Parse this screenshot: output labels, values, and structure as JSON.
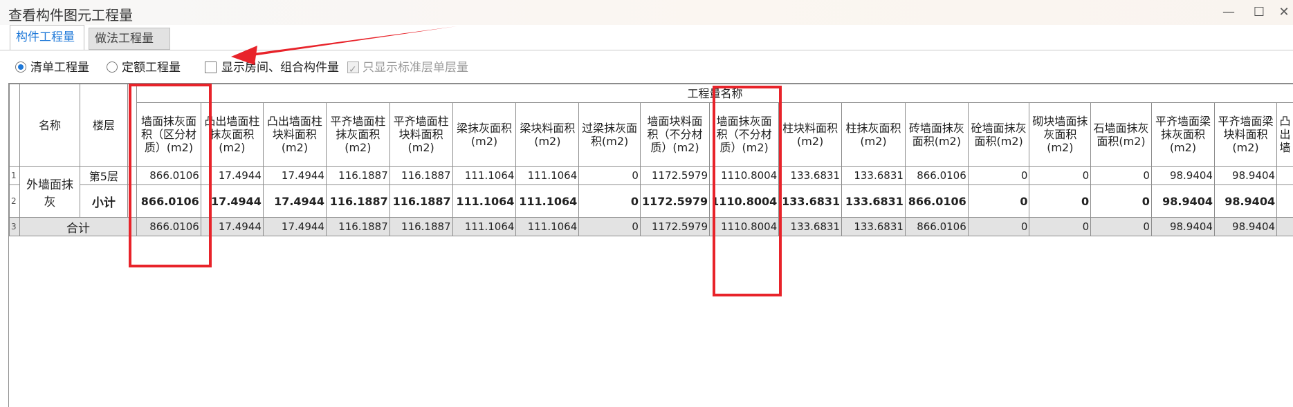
{
  "window": {
    "title": "查看构件图元工程量",
    "minimize_glyph": "—",
    "maximize_glyph": "☐",
    "close_glyph": "✕"
  },
  "tabs": [
    {
      "label": "构件工程量",
      "active": true
    },
    {
      "label": "做法工程量",
      "active": false
    }
  ],
  "options": {
    "list_qty": "清单工程量",
    "quota_qty": "定额工程量",
    "show_room": "显示房间、组合构件量",
    "std_floor_only": "只显示标准层单层量"
  },
  "table": {
    "group_header": "工程量名称",
    "name_header": "名称",
    "floor_header": "楼层",
    "columns": [
      "墙面抹灰面积（区分材质）(m2)",
      "凸出墙面柱抹灰面积(m2)",
      "凸出墙面柱块料面积(m2)",
      "平齐墙面柱抹灰面积(m2)",
      "平齐墙面柱块料面积(m2)",
      "梁抹灰面积(m2)",
      "梁块料面积(m2)",
      "过梁抹灰面积(m2)",
      "墙面块料面积（不分材质）(m2)",
      "墙面抹灰面积（不分材质）(m2)",
      "柱块料面积(m2)",
      "柱抹灰面积(m2)",
      "砖墙面抹灰面积(m2)",
      "砼墙面抹灰面积(m2)",
      "砌块墙面抹灰面积(m2)",
      "石墙面抹灰面积(m2)",
      "平齐墙面梁抹灰面积(m2)",
      "平齐墙面梁块料面积(m2)",
      "凸出墙"
    ],
    "rows": [
      {
        "rownum": "1",
        "name": "外墙面抹灰",
        "floor": "第5层",
        "values": [
          "866.0106",
          "17.4944",
          "17.4944",
          "116.1887",
          "116.1887",
          "111.1064",
          "111.1064",
          "0",
          "1172.5979",
          "1110.8004",
          "133.6831",
          "133.6831",
          "866.0106",
          "0",
          "0",
          "0",
          "98.9404",
          "98.9404",
          ""
        ]
      },
      {
        "rownum": "2",
        "floor": "小计",
        "values": [
          "866.0106",
          "17.4944",
          "17.4944",
          "116.1887",
          "116.1887",
          "111.1064",
          "111.1064",
          "0",
          "1172.5979",
          "1110.8004",
          "133.6831",
          "133.6831",
          "866.0106",
          "0",
          "0",
          "0",
          "98.9404",
          "98.9404",
          ""
        ]
      },
      {
        "rownum": "3",
        "name": "合计",
        "values": [
          "866.0106",
          "17.4944",
          "17.4944",
          "116.1887",
          "116.1887",
          "111.1064",
          "111.1064",
          "0",
          "1172.5979",
          "1110.8004",
          "133.6831",
          "133.6831",
          "866.0106",
          "0",
          "0",
          "0",
          "98.9404",
          "98.9404",
          ""
        ]
      }
    ]
  },
  "annotation_color": "#e8232a",
  "accent_color": "#1e78d8"
}
